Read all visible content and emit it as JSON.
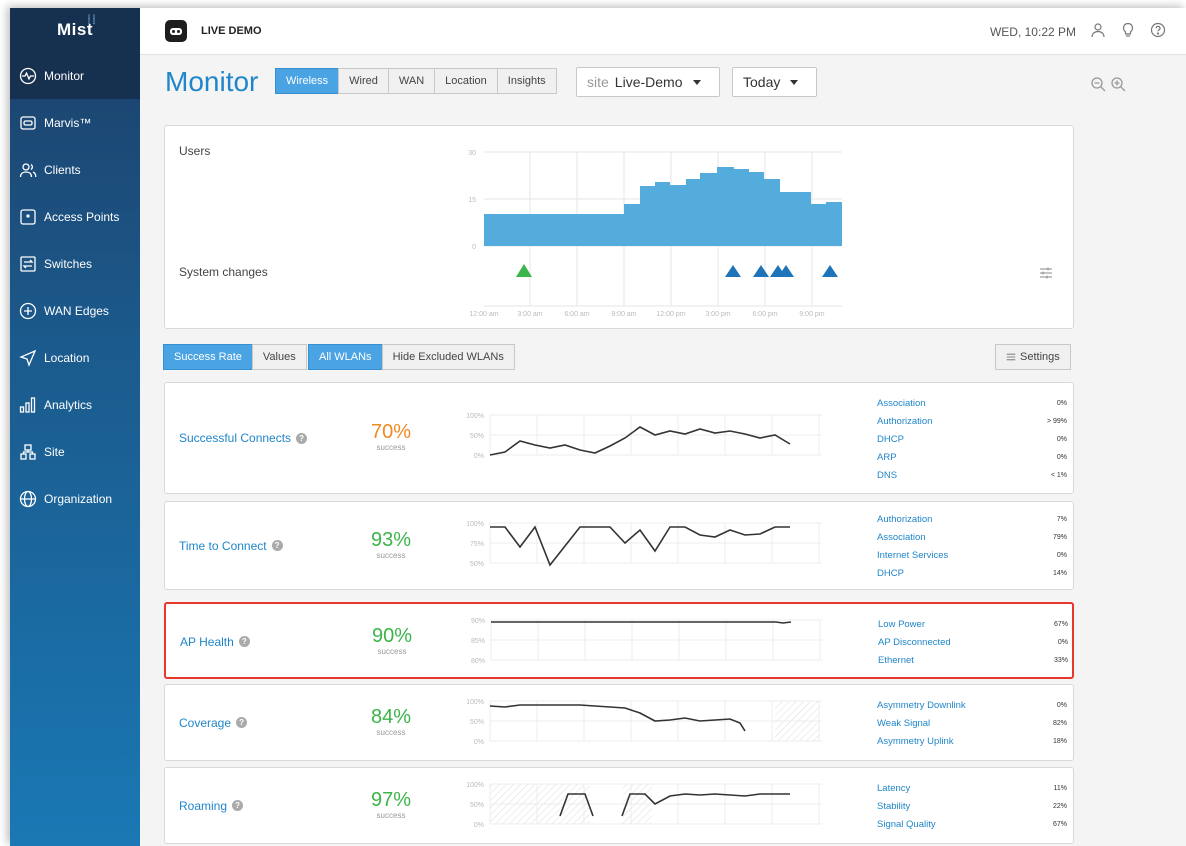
{
  "sidebar": {
    "logo": "Mist",
    "items": [
      {
        "label": "Monitor",
        "icon": "monitor-icon",
        "active": true
      },
      {
        "label": "Marvis™",
        "icon": "marvis-icon"
      },
      {
        "label": "Clients",
        "icon": "clients-icon"
      },
      {
        "label": "Access Points",
        "icon": "access-point-icon"
      },
      {
        "label": "Switches",
        "icon": "switch-icon"
      },
      {
        "label": "WAN Edges",
        "icon": "wan-edge-icon"
      },
      {
        "label": "Location",
        "icon": "location-icon"
      },
      {
        "label": "Analytics",
        "icon": "analytics-icon"
      },
      {
        "label": "Site",
        "icon": "site-icon"
      },
      {
        "label": "Organization",
        "icon": "organization-icon"
      }
    ]
  },
  "topbar": {
    "org": "LIVE DEMO",
    "datetime": "WED, 10:22 PM"
  },
  "header": {
    "title": "Monitor",
    "tabs": [
      "Wireless",
      "Wired",
      "WAN",
      "Location",
      "Insights"
    ],
    "active_tab": "Wireless",
    "site_prefix": "site",
    "site_value": "Live-Demo",
    "range_value": "Today"
  },
  "users_panel": {
    "users_label": "Users",
    "changes_label": "System changes",
    "y_ticks": [
      "30",
      "15",
      "0"
    ],
    "x_ticks": [
      "12:00 am",
      "3:00 am",
      "6:00 am",
      "9:00 am",
      "12:00 pm",
      "3:00 pm",
      "6:00 pm",
      "9:00 pm"
    ]
  },
  "controls": {
    "success_rate": "Success Rate",
    "values": "Values",
    "all_wlans": "All WLANs",
    "hide_excluded": "Hide Excluded WLANs",
    "settings": "Settings"
  },
  "metrics": [
    {
      "name": "Successful Connects",
      "pct": "70%",
      "sub": "success",
      "color": "#f08a24",
      "y_ticks": [
        "100%",
        "50%",
        "0%"
      ],
      "classifiers": [
        [
          "Association",
          "0%"
        ],
        [
          "Authorization",
          "> 99%"
        ],
        [
          "DHCP",
          "0%"
        ],
        [
          "ARP",
          "0%"
        ],
        [
          "DNS",
          "< 1%"
        ]
      ]
    },
    {
      "name": "Time to Connect",
      "pct": "93%",
      "sub": "success",
      "color": "#3bb54a",
      "y_ticks": [
        "100%",
        "75%",
        "50%"
      ],
      "classifiers": [
        [
          "Authorization",
          "7%"
        ],
        [
          "Association",
          "79%"
        ],
        [
          "Internet Services",
          "0%"
        ],
        [
          "DHCP",
          "14%"
        ]
      ]
    },
    {
      "name": "AP Health",
      "pct": "90%",
      "sub": "success",
      "color": "#3bb54a",
      "y_ticks": [
        "90%",
        "85%",
        "80%"
      ],
      "classifiers": [
        [
          "Low Power",
          "67%"
        ],
        [
          "AP Disconnected",
          "0%"
        ],
        [
          "Ethernet",
          "33%"
        ]
      ]
    },
    {
      "name": "Coverage",
      "pct": "84%",
      "sub": "success",
      "color": "#3bb54a",
      "y_ticks": [
        "100%",
        "50%",
        "0%"
      ],
      "classifiers": [
        [
          "Asymmetry Downlink",
          "0%"
        ],
        [
          "Weak Signal",
          "82%"
        ],
        [
          "Asymmetry Uplink",
          "18%"
        ]
      ]
    },
    {
      "name": "Roaming",
      "pct": "97%",
      "sub": "success",
      "color": "#3bb54a",
      "y_ticks": [
        "100%",
        "50%",
        "0%"
      ],
      "classifiers": [
        [
          "Latency",
          "11%"
        ],
        [
          "Stability",
          "22%"
        ],
        [
          "Signal Quality",
          "67%"
        ]
      ]
    }
  ]
}
